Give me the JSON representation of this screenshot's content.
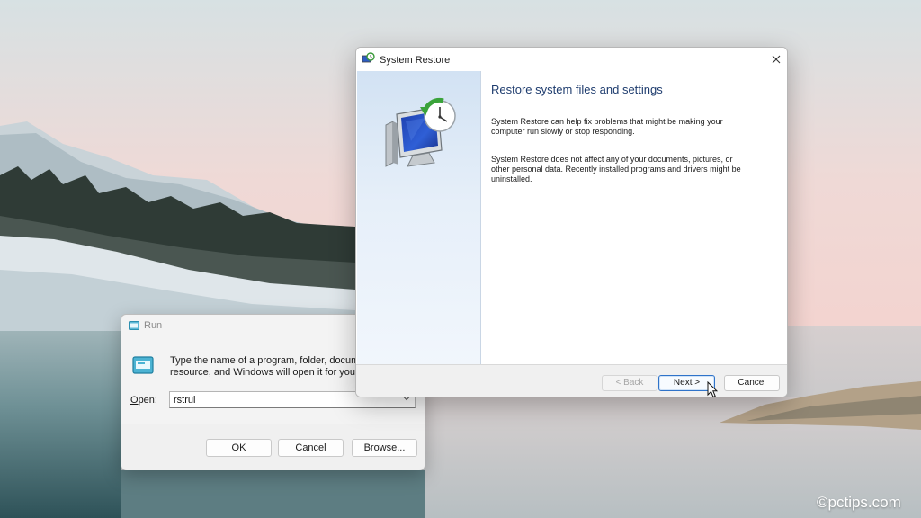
{
  "run_dialog": {
    "title": "Run",
    "description": "Type the name of a program, folder, document, or Internet\nresource, and Windows will open it for you.",
    "open_label_accel": "O",
    "open_label_rest": "pen:",
    "input_value": "rstrui",
    "ok_label": "OK",
    "cancel_label": "Cancel",
    "browse_label": "Browse..."
  },
  "system_restore": {
    "title": "System Restore",
    "heading": "Restore system files and settings",
    "paragraph1": "System Restore can help fix problems that might be making your\ncomputer run slowly or stop responding.",
    "paragraph2": "System Restore does not affect any of your documents, pictures, or\nother personal data. Recently installed programs and drivers might be\nuninstalled.",
    "back_label": "< Back",
    "next_label": "Next >",
    "cancel_label": "Cancel"
  },
  "watermark": "©pctips.com",
  "colors": {
    "accent": "#2f73c9",
    "heading": "#1e3c6e",
    "sidebar_top": "#d2e2f3"
  },
  "icons": [
    "run-icon",
    "system-restore-icon",
    "close-icon",
    "chevron-down-icon",
    "mouse-cursor-icon"
  ]
}
